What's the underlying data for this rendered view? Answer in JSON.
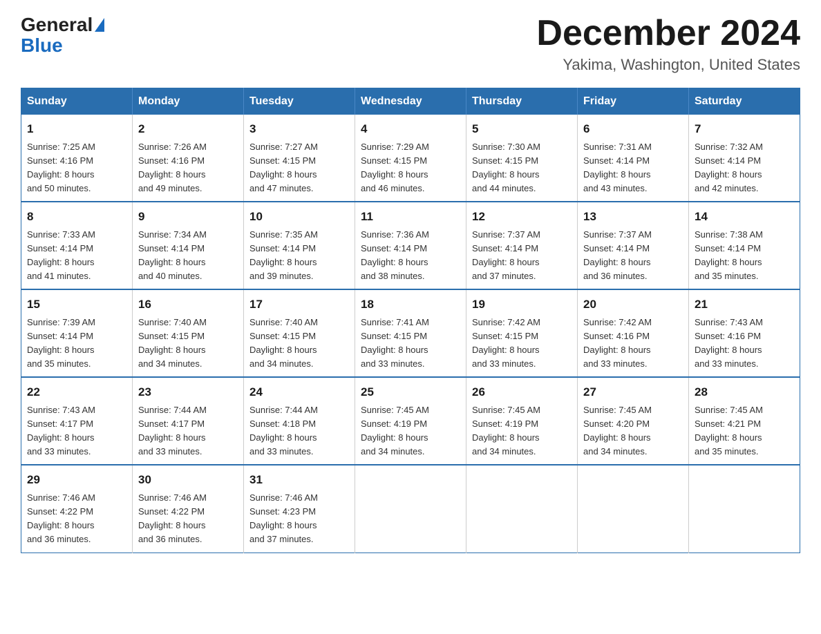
{
  "header": {
    "logo_general": "General",
    "logo_blue": "Blue",
    "title": "December 2024",
    "subtitle": "Yakima, Washington, United States"
  },
  "calendar": {
    "days_of_week": [
      "Sunday",
      "Monday",
      "Tuesday",
      "Wednesday",
      "Thursday",
      "Friday",
      "Saturday"
    ],
    "weeks": [
      [
        {
          "day": "1",
          "sunrise": "7:25 AM",
          "sunset": "4:16 PM",
          "daylight": "8 hours and 50 minutes."
        },
        {
          "day": "2",
          "sunrise": "7:26 AM",
          "sunset": "4:16 PM",
          "daylight": "8 hours and 49 minutes."
        },
        {
          "day": "3",
          "sunrise": "7:27 AM",
          "sunset": "4:15 PM",
          "daylight": "8 hours and 47 minutes."
        },
        {
          "day": "4",
          "sunrise": "7:29 AM",
          "sunset": "4:15 PM",
          "daylight": "8 hours and 46 minutes."
        },
        {
          "day": "5",
          "sunrise": "7:30 AM",
          "sunset": "4:15 PM",
          "daylight": "8 hours and 44 minutes."
        },
        {
          "day": "6",
          "sunrise": "7:31 AM",
          "sunset": "4:14 PM",
          "daylight": "8 hours and 43 minutes."
        },
        {
          "day": "7",
          "sunrise": "7:32 AM",
          "sunset": "4:14 PM",
          "daylight": "8 hours and 42 minutes."
        }
      ],
      [
        {
          "day": "8",
          "sunrise": "7:33 AM",
          "sunset": "4:14 PM",
          "daylight": "8 hours and 41 minutes."
        },
        {
          "day": "9",
          "sunrise": "7:34 AM",
          "sunset": "4:14 PM",
          "daylight": "8 hours and 40 minutes."
        },
        {
          "day": "10",
          "sunrise": "7:35 AM",
          "sunset": "4:14 PM",
          "daylight": "8 hours and 39 minutes."
        },
        {
          "day": "11",
          "sunrise": "7:36 AM",
          "sunset": "4:14 PM",
          "daylight": "8 hours and 38 minutes."
        },
        {
          "day": "12",
          "sunrise": "7:37 AM",
          "sunset": "4:14 PM",
          "daylight": "8 hours and 37 minutes."
        },
        {
          "day": "13",
          "sunrise": "7:37 AM",
          "sunset": "4:14 PM",
          "daylight": "8 hours and 36 minutes."
        },
        {
          "day": "14",
          "sunrise": "7:38 AM",
          "sunset": "4:14 PM",
          "daylight": "8 hours and 35 minutes."
        }
      ],
      [
        {
          "day": "15",
          "sunrise": "7:39 AM",
          "sunset": "4:14 PM",
          "daylight": "8 hours and 35 minutes."
        },
        {
          "day": "16",
          "sunrise": "7:40 AM",
          "sunset": "4:15 PM",
          "daylight": "8 hours and 34 minutes."
        },
        {
          "day": "17",
          "sunrise": "7:40 AM",
          "sunset": "4:15 PM",
          "daylight": "8 hours and 34 minutes."
        },
        {
          "day": "18",
          "sunrise": "7:41 AM",
          "sunset": "4:15 PM",
          "daylight": "8 hours and 33 minutes."
        },
        {
          "day": "19",
          "sunrise": "7:42 AM",
          "sunset": "4:15 PM",
          "daylight": "8 hours and 33 minutes."
        },
        {
          "day": "20",
          "sunrise": "7:42 AM",
          "sunset": "4:16 PM",
          "daylight": "8 hours and 33 minutes."
        },
        {
          "day": "21",
          "sunrise": "7:43 AM",
          "sunset": "4:16 PM",
          "daylight": "8 hours and 33 minutes."
        }
      ],
      [
        {
          "day": "22",
          "sunrise": "7:43 AM",
          "sunset": "4:17 PM",
          "daylight": "8 hours and 33 minutes."
        },
        {
          "day": "23",
          "sunrise": "7:44 AM",
          "sunset": "4:17 PM",
          "daylight": "8 hours and 33 minutes."
        },
        {
          "day": "24",
          "sunrise": "7:44 AM",
          "sunset": "4:18 PM",
          "daylight": "8 hours and 33 minutes."
        },
        {
          "day": "25",
          "sunrise": "7:45 AM",
          "sunset": "4:19 PM",
          "daylight": "8 hours and 34 minutes."
        },
        {
          "day": "26",
          "sunrise": "7:45 AM",
          "sunset": "4:19 PM",
          "daylight": "8 hours and 34 minutes."
        },
        {
          "day": "27",
          "sunrise": "7:45 AM",
          "sunset": "4:20 PM",
          "daylight": "8 hours and 34 minutes."
        },
        {
          "day": "28",
          "sunrise": "7:45 AM",
          "sunset": "4:21 PM",
          "daylight": "8 hours and 35 minutes."
        }
      ],
      [
        {
          "day": "29",
          "sunrise": "7:46 AM",
          "sunset": "4:22 PM",
          "daylight": "8 hours and 36 minutes."
        },
        {
          "day": "30",
          "sunrise": "7:46 AM",
          "sunset": "4:22 PM",
          "daylight": "8 hours and 36 minutes."
        },
        {
          "day": "31",
          "sunrise": "7:46 AM",
          "sunset": "4:23 PM",
          "daylight": "8 hours and 37 minutes."
        },
        null,
        null,
        null,
        null
      ]
    ],
    "labels": {
      "sunrise": "Sunrise:",
      "sunset": "Sunset:",
      "daylight": "Daylight:"
    }
  }
}
